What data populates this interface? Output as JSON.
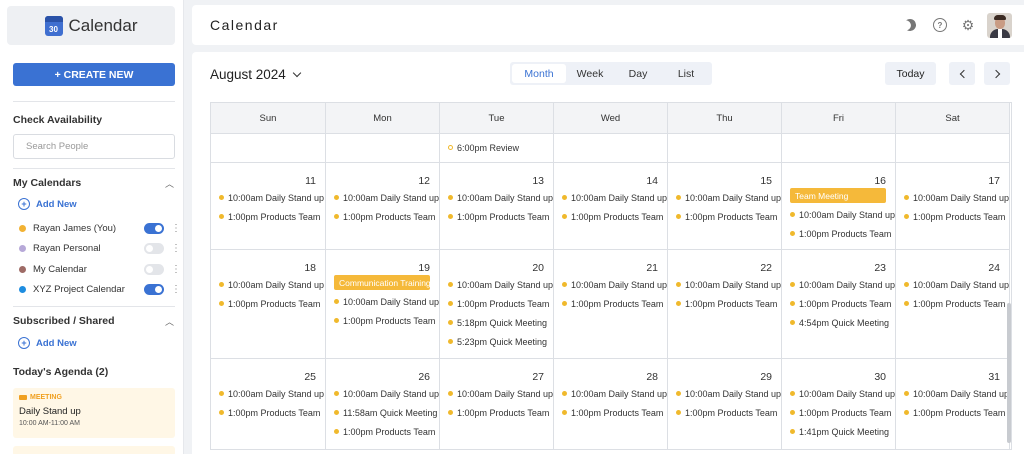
{
  "app": {
    "name": "Calendar",
    "logo_number": "30"
  },
  "sidebar": {
    "create_label": "+ CREATE NEW",
    "check_availability": "Check Availability",
    "search_placeholder": "Search People",
    "my_calendars_title": "My Calendars",
    "add_new": "Add New",
    "calendars": [
      {
        "name": "Rayan James (You)",
        "color": "#f2b233",
        "enabled": true
      },
      {
        "name": "Rayan Personal",
        "color": "#b7a9d8",
        "enabled": false
      },
      {
        "name": "My Calendar",
        "color": "#9e6b66",
        "enabled": false
      },
      {
        "name": "XYZ Project Calendar",
        "color": "#1e8de0",
        "enabled": true
      }
    ],
    "subscribed_title": "Subscribed / Shared",
    "agenda_title": "Today's Agenda (2)",
    "agenda": [
      {
        "tag": "MEETING",
        "title": "Daily Stand up",
        "time": "10:00 AM-11:00 AM"
      }
    ]
  },
  "header": {
    "title": "Calendar"
  },
  "toolbar": {
    "month_label": "August 2024",
    "views": [
      "Month",
      "Week",
      "Day",
      "List"
    ],
    "active_view": "Month",
    "today_label": "Today"
  },
  "calendar": {
    "weekdays": [
      "Sun",
      "Mon",
      "Tue",
      "Wed",
      "Thu",
      "Fri",
      "Sat"
    ],
    "partial_row": [
      {
        "events": []
      },
      {
        "events": []
      },
      {
        "events": [
          {
            "text": "6:00pm Review",
            "hollow": true
          }
        ]
      },
      {
        "events": []
      },
      {
        "events": []
      },
      {
        "events": []
      },
      {
        "events": []
      }
    ],
    "weeks": [
      [
        {
          "date": "11",
          "events": [
            {
              "text": "10:00am Daily Stand up"
            },
            {
              "text": "1:00pm Products Team"
            }
          ]
        },
        {
          "date": "12",
          "events": [
            {
              "text": "10:00am Daily Stand up"
            },
            {
              "text": "1:00pm Products Team"
            }
          ]
        },
        {
          "date": "13",
          "events": [
            {
              "text": "10:00am Daily Stand up"
            },
            {
              "text": "1:00pm Products Team"
            }
          ]
        },
        {
          "date": "14",
          "events": [
            {
              "text": "10:00am Daily Stand up"
            },
            {
              "text": "1:00pm Products Team"
            }
          ]
        },
        {
          "date": "15",
          "events": [
            {
              "text": "10:00am Daily Stand up"
            },
            {
              "text": "1:00pm Products Team"
            }
          ]
        },
        {
          "date": "16",
          "banner": "Team Meeting",
          "events": [
            {
              "text": "10:00am Daily Stand up"
            },
            {
              "text": "1:00pm Products Team"
            }
          ]
        },
        {
          "date": "17",
          "events": [
            {
              "text": "10:00am Daily Stand up"
            },
            {
              "text": "1:00pm Products Team"
            }
          ]
        }
      ],
      [
        {
          "date": "18",
          "events": [
            {
              "text": "10:00am Daily Stand up"
            },
            {
              "text": "1:00pm Products Team"
            }
          ]
        },
        {
          "date": "19",
          "banner": "Communication Training",
          "events": [
            {
              "text": "10:00am Daily Stand up"
            },
            {
              "text": "1:00pm Products Team"
            }
          ]
        },
        {
          "date": "20",
          "events": [
            {
              "text": "10:00am Daily Stand up"
            },
            {
              "text": "1:00pm Products Team"
            },
            {
              "text": "5:18pm Quick Meeting"
            },
            {
              "text": "5:23pm Quick Meeting"
            }
          ]
        },
        {
          "date": "21",
          "events": [
            {
              "text": "10:00am Daily Stand up"
            },
            {
              "text": "1:00pm Products Team"
            }
          ]
        },
        {
          "date": "22",
          "events": [
            {
              "text": "10:00am Daily Stand up"
            },
            {
              "text": "1:00pm Products Team"
            }
          ]
        },
        {
          "date": "23",
          "events": [
            {
              "text": "10:00am Daily Stand up"
            },
            {
              "text": "1:00pm Products Team"
            },
            {
              "text": "4:54pm Quick Meeting"
            }
          ]
        },
        {
          "date": "24",
          "events": [
            {
              "text": "10:00am Daily Stand up"
            },
            {
              "text": "1:00pm Products Team"
            }
          ]
        }
      ],
      [
        {
          "date": "25",
          "events": [
            {
              "text": "10:00am Daily Stand up"
            },
            {
              "text": "1:00pm Products Team"
            }
          ]
        },
        {
          "date": "26",
          "events": [
            {
              "text": "10:00am Daily Stand up"
            },
            {
              "text": "11:58am Quick Meeting"
            },
            {
              "text": "1:00pm Products Team"
            }
          ]
        },
        {
          "date": "27",
          "events": [
            {
              "text": "10:00am Daily Stand up"
            },
            {
              "text": "1:00pm Products Team"
            }
          ]
        },
        {
          "date": "28",
          "events": [
            {
              "text": "10:00am Daily Stand up"
            },
            {
              "text": "1:00pm Products Team"
            }
          ]
        },
        {
          "date": "29",
          "events": [
            {
              "text": "10:00am Daily Stand up"
            },
            {
              "text": "1:00pm Products Team"
            }
          ]
        },
        {
          "date": "30",
          "events": [
            {
              "text": "10:00am Daily Stand up"
            },
            {
              "text": "1:00pm Products Team"
            },
            {
              "text": "1:41pm Quick Meeting"
            }
          ]
        },
        {
          "date": "31",
          "events": [
            {
              "text": "10:00am Daily Stand up"
            },
            {
              "text": "1:00pm Products Team"
            }
          ]
        }
      ]
    ]
  }
}
